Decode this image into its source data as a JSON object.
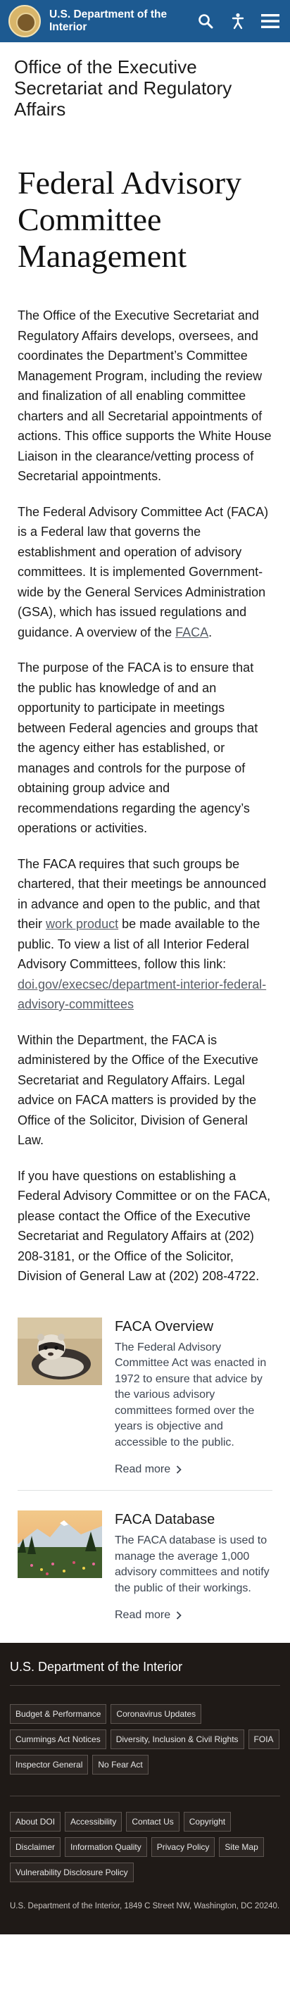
{
  "header": {
    "site_name": "U.S. Department of the Interior",
    "icons": [
      "seal-logo",
      "search-icon",
      "accessibility-icon",
      "menu-icon"
    ]
  },
  "office": {
    "title": "Office of the Executive Secretariat and Regulatory Affairs"
  },
  "main": {
    "title": "Federal Advisory Committee Management",
    "p1": "The Office of the Executive Secretariat and Regulatory Affairs develops, oversees, and coordinates the Department’s Committee Management Program, including the review and finalization of all enabling committee charters and all Secretarial appointments of actions. This office supports the White House Liaison in the clearance/vetting process of Secretarial appointments.",
    "p2_text": "The Federal Advisory Committee Act (FACA) is a Federal law that governs the establishment and operation of advisory committees.  It is implemented Government-wide by the General Services Administration (GSA), which has issued regulations and guidance. A overview of the ",
    "p2_link": "FACA",
    "p2_end": ".",
    "p3": "The purpose of the FACA is to ensure that the public has knowledge of and an opportunity to participate in meetings between Federal agencies and groups that the agency either has established, or manages and controls for the purpose of obtaining group advice and recommendations regarding the agency’s operations or activities.",
    "p4_a": "The FACA requires that such groups be chartered, that their meetings be announced in advance and open to the public, and that their ",
    "p4_link1": "work product",
    "p4_b": " be made available to the public.  To view a list of all Interior Federal Advisory Committees, follow this link: ",
    "p4_link2": "doi.gov/execsec/department-interior-federal-advisory-committees",
    "p5": "Within the Department, the FACA is administered by the Office of the Executive Secretariat and Regulatory Affairs.  Legal advice on FACA matters is provided by the Office of the Solicitor, Division of General Law.",
    "p6": "If you have questions on establishing a Federal Advisory Committee or on the FACA, please contact the Office of the Executive Secretariat and Regulatory Affairs at (202) 208-3181, or the Office of the Solicitor, Division of General Law at (202) 208-4722."
  },
  "cards": [
    {
      "title": "FACA Overview",
      "text": "The Federal Advisory Committee Act was enacted in 1972 to ensure that advice by the various advisory committees formed over the years is objective and accessible to the public.",
      "link": "Read more"
    },
    {
      "title": "FACA Database",
      "text": "The FACA database is used to manage the average 1,000 advisory committees and notify the public of their workings.",
      "link": "Read more"
    }
  ],
  "footer": {
    "title": "U.S. Department of the Interior",
    "links_primary": [
      "Budget & Performance",
      "Coronavirus Updates",
      "Cummings Act Notices",
      "Diversity, Inclusion & Civil Rights",
      "FOIA",
      "Inspector General",
      "No Fear Act"
    ],
    "links_secondary": [
      "About DOI",
      "Accessibility",
      "Contact Us",
      "Copyright",
      "Disclaimer",
      "Information Quality",
      "Privacy Policy",
      "Site Map",
      "Vulnerability Disclosure Policy"
    ],
    "address": "U.S. Department of the Interior, 1849 C Street NW, Washington, DC 20240."
  },
  "colors": {
    "header_bg": "#1d5a91",
    "footer_bg": "#1f1a17",
    "link": "#565c65"
  }
}
